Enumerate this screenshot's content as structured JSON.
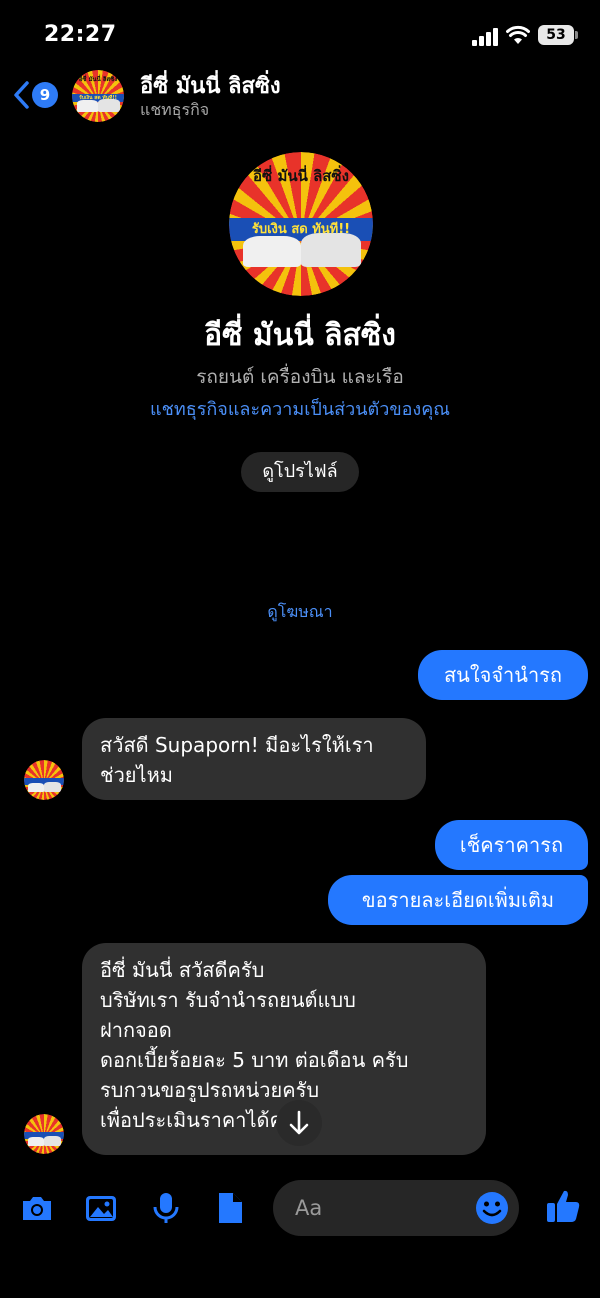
{
  "status_bar": {
    "time": "22:27",
    "battery": "53"
  },
  "header": {
    "back_badge": "9",
    "name": "อีซี่ มันนี่ ลิสซิ่ง",
    "subtitle": "แชทธุรกิจ"
  },
  "profile": {
    "name": "อีซี่ มันนี่ ลิสซิ่ง",
    "category": "รถยนต์ เครื่องบิน และเรือ",
    "privacy_link": "แชทธุรกิจและความเป็นส่วนตัวของคุณ",
    "view_profile_label": "ดูโปรไฟล์"
  },
  "logo": {
    "top_text": "อีซี่ มันนี่ ลิสซิ่ง",
    "band_text": "รับเงิน สด ทันที!!"
  },
  "view_ad_label": "ดูโฆษณา",
  "messages": [
    {
      "from": "me",
      "text": "สนใจจำนำรถ"
    },
    {
      "from": "them",
      "lines": [
        "สวัสดี Supaporn! มีอะไรให้เรา",
        "ช่วยไหม"
      ]
    },
    {
      "from": "me",
      "text": "เช็คราคารถ"
    },
    {
      "from": "me",
      "text": "ขอรายละเอียดเพิ่มเติม"
    },
    {
      "from": "them",
      "lines": [
        "อีซี่ มันนี่ สวัสดีครับ",
        "บริษัทเรา รับจำนำรถยนต์แบบ",
        "ฝากจอด",
        "ดอกเบี้ยร้อยละ 5 บาท ต่อเดือน ครับ",
        "รบกวนขอรูปรถหน่วยครับ",
        "เพื่อประเมินราคาได้ครับ"
      ]
    }
  ],
  "composer": {
    "placeholder": "Aa"
  },
  "colors": {
    "accent": "#2478ff",
    "link": "#4b8ff7",
    "incoming_bubble": "#303030",
    "background": "#000000"
  },
  "icons": [
    "back-chevron-icon",
    "camera-icon",
    "image-icon",
    "microphone-icon",
    "document-icon",
    "emoji-icon",
    "thumbs-up-icon",
    "arrow-down-icon"
  ]
}
